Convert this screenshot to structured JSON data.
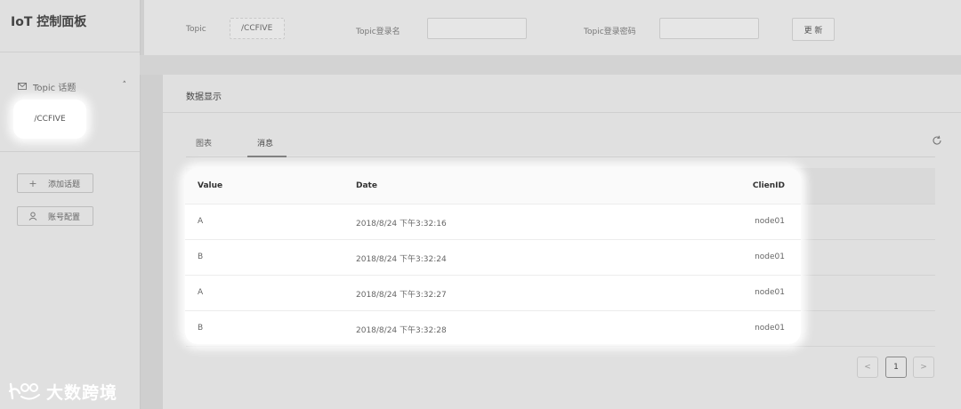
{
  "app": {
    "title": "IoT 控制面板"
  },
  "sidebar": {
    "menu_head": {
      "icon": "mail-icon",
      "label": "Topic 话题",
      "chevron": "˄"
    },
    "topic_item": "/CCFIVE",
    "add_button": {
      "icon": "plus-icon",
      "label": "添加话题"
    },
    "account_button": {
      "icon": "user-icon",
      "label": "账号配置"
    }
  },
  "topbar": {
    "topic_label": "Topic",
    "topic_value": "/CCFIVE",
    "login_label": "Topic登录名",
    "login_value": "",
    "password_label": "Topic登录密码",
    "password_value": "",
    "update_label": "更 新"
  },
  "card": {
    "title": "数据显示",
    "tabs": [
      {
        "label": "图表",
        "active": false
      },
      {
        "label": "消息",
        "active": true
      }
    ]
  },
  "table": {
    "columns": [
      "Value",
      "Date",
      "ClienID"
    ],
    "rows": [
      {
        "value": "A",
        "date": "2018/8/24 下午3:32:16",
        "client": "node01"
      },
      {
        "value": "B",
        "date": "2018/8/24 下午3:32:24",
        "client": "node01"
      },
      {
        "value": "A",
        "date": "2018/8/24 下午3:32:27",
        "client": "node01"
      },
      {
        "value": "B",
        "date": "2018/8/24 下午3:32:28",
        "client": "node01"
      }
    ]
  },
  "pagination": {
    "prev": "<",
    "current": "1",
    "next": ">"
  },
  "watermark": {
    "text": "大数跨境"
  }
}
